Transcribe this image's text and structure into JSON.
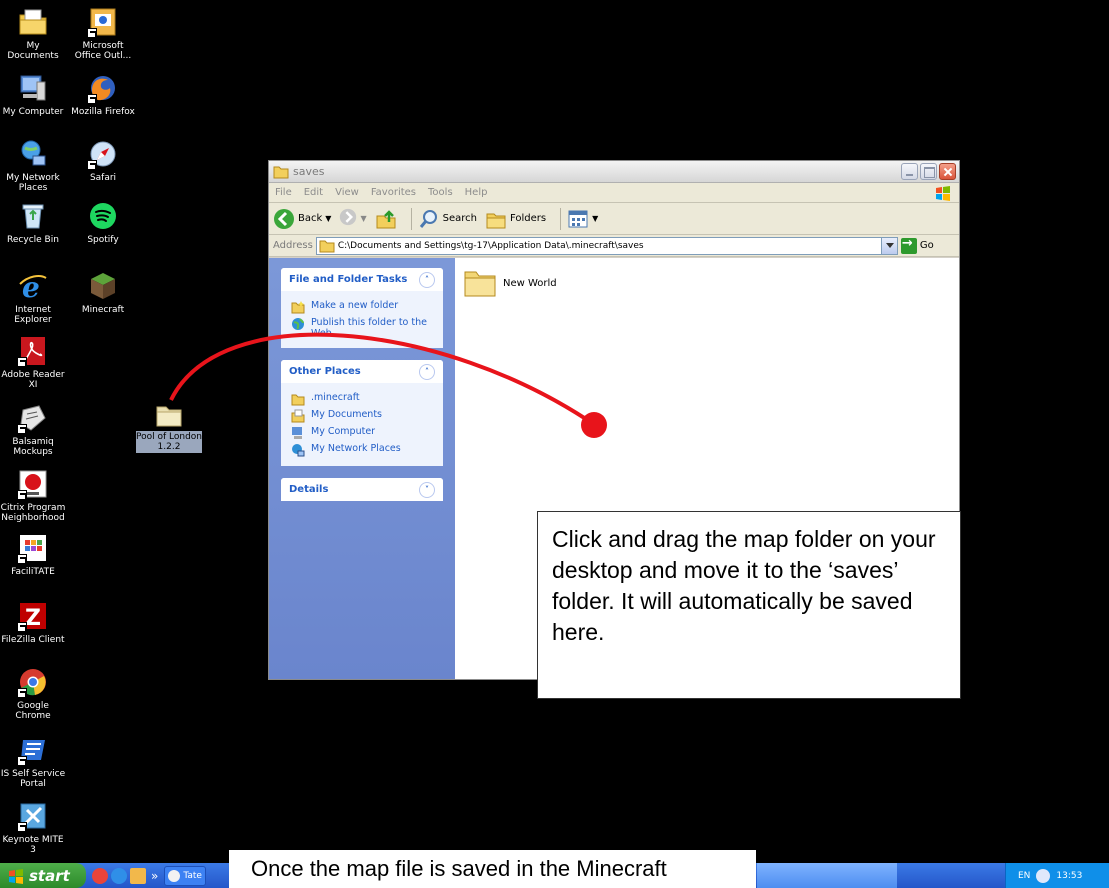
{
  "desktop_icons": [
    {
      "label": "My Documents",
      "icon": "my-documents-icon"
    },
    {
      "label": "Microsoft Office Outl...",
      "icon": "outlook-icon"
    },
    {
      "label": "My Computer",
      "icon": "my-computer-icon"
    },
    {
      "label": "Mozilla Firefox",
      "icon": "firefox-icon"
    },
    {
      "label": "My Network Places",
      "icon": "network-places-icon"
    },
    {
      "label": "Safari",
      "icon": "safari-icon"
    },
    {
      "label": "Recycle Bin",
      "icon": "recycle-bin-icon"
    },
    {
      "label": "Spotify",
      "icon": "spotify-icon"
    },
    {
      "label": "Internet Explorer",
      "icon": "internet-explorer-icon"
    },
    {
      "label": "Minecraft",
      "icon": "minecraft-icon"
    },
    {
      "label": "Adobe Reader XI",
      "icon": "adobe-reader-icon"
    },
    {
      "label": "Balsamiq Mockups",
      "icon": "balsamiq-icon"
    },
    {
      "label": "Citrix Program Neighborhood",
      "icon": "citrix-icon"
    },
    {
      "label": "FaciliTATE",
      "icon": "facilitate-icon"
    },
    {
      "label": "FileZilla Client",
      "icon": "filezilla-icon"
    },
    {
      "label": "Google Chrome",
      "icon": "chrome-icon"
    },
    {
      "label": "IS Self Service Portal",
      "icon": "self-service-icon"
    },
    {
      "label": "Keynote MITE 3",
      "icon": "keynote-icon"
    }
  ],
  "drag_folder": {
    "label": "Pool of London 1.2.2"
  },
  "window": {
    "title": "saves",
    "menu": [
      "File",
      "Edit",
      "View",
      "Favorites",
      "Tools",
      "Help"
    ],
    "toolbar": {
      "back": "Back",
      "search": "Search",
      "folders": "Folders"
    },
    "address": {
      "label": "Address",
      "path": "C:\\Documents and Settings\\tg-17\\Application Data\\.minecraft\\saves",
      "go": "Go"
    },
    "tasks": {
      "title": "File and Folder Tasks",
      "items": [
        "Make a new folder",
        "Publish this folder to the Web"
      ]
    },
    "other_places": {
      "title": "Other Places",
      "items": [
        ".minecraft",
        "My Documents",
        "My Computer",
        "My Network Places"
      ]
    },
    "details": {
      "title": "Details"
    },
    "folders": [
      {
        "name": "New World"
      }
    ]
  },
  "callouts": {
    "main": "Click and drag the map folder on your desktop and move it to the ‘saves’ folder. It will automatically be saved here.",
    "bottom": "Once the map file is saved in the Minecraft"
  },
  "taskbar": {
    "start": "start",
    "task_label": "Tate",
    "more": "»",
    "lang": "EN",
    "time": "13:53"
  },
  "colors": {
    "arrow": "#e8141b",
    "taskbar": "#2456c9",
    "task_pane": "#7c98d8"
  }
}
